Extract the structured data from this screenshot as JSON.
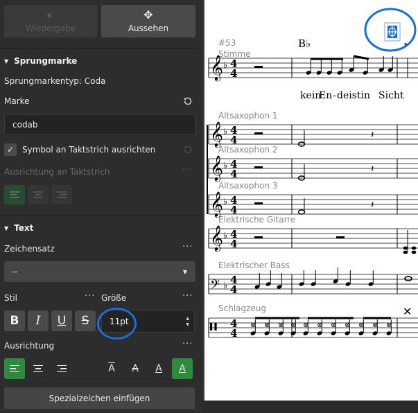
{
  "tabs": {
    "playback": "Wiedergabe",
    "appearance": "Aussehen"
  },
  "jump_section": {
    "title": "Sprungmarke",
    "type_label": "Sprungmarkentyp: Coda",
    "marker_label": "Marke",
    "marker_value": "codab",
    "align_checkbox_label": "Symbol an Taktstrich ausrichten",
    "align_barline_label": "Ausrichtung an Taktstrich"
  },
  "text_section": {
    "title": "Text",
    "font_label": "Zeichensatz",
    "font_value": "--",
    "style_label": "Stil",
    "size_label": "Größe",
    "size_value": "11pt",
    "alignment_label": "Ausrichtung",
    "special_button": "Spezialzeichen einfügen"
  },
  "format_buttons": {
    "bold": "B",
    "italic": "I",
    "underline": "U",
    "strike": "S"
  },
  "vertical_align_glyph": "A",
  "score": {
    "measure_number": "#53",
    "chord_symbol": "B♭",
    "lyrics": [
      "kein",
      "En",
      "-",
      "deistin",
      "Sicht"
    ],
    "instruments": [
      "Stimme",
      "Altsaxophon 1",
      "Altsaxophon 2",
      "Altsaxophon 3",
      "Elektrische Gitarre",
      "Elektrischer Bass",
      "Schlagzeug"
    ],
    "time_signature": "4/4"
  },
  "colors": {
    "accent_green": "#2f8a3e",
    "annotation_blue": "#1a6fd6"
  }
}
